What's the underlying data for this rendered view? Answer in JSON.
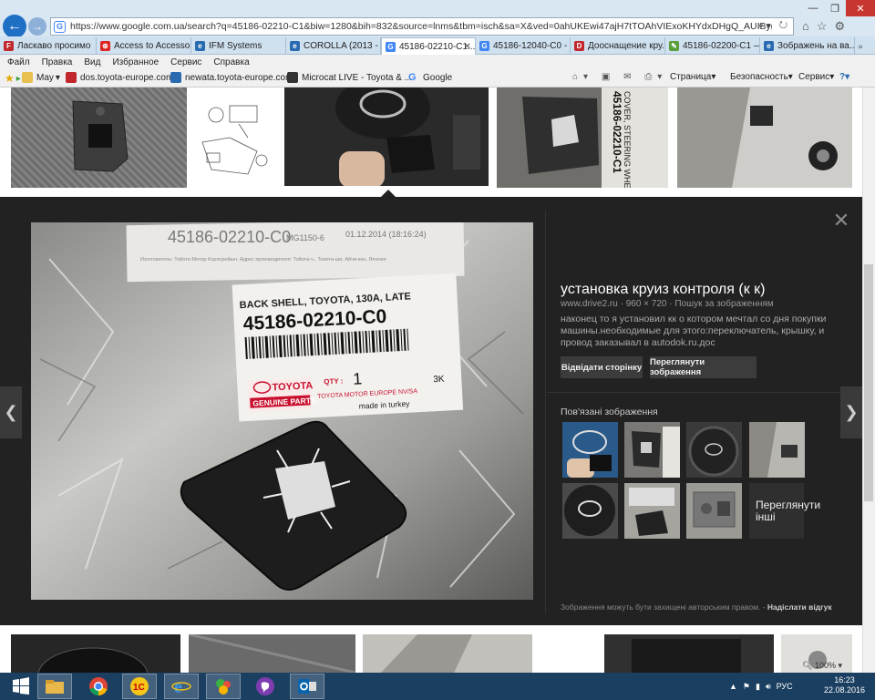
{
  "browser": {
    "url": "https://www.google.com.ua/search?q=45186-02210-C1&biw=1280&bih=832&source=lnms&tbm=isch&sa=X&ved=0ahUKEwi47ajH7tTOAhVIExoKHYdxDHgQ_AUIBygC&dpr=1#imgdii=2TJgQxLiM...",
    "tabs": [
      {
        "label": "Ласкаво просимо",
        "icon_color": "#c1272d"
      },
      {
        "label": "Access to Accessor...",
        "icon_color": "#d22"
      },
      {
        "label": "IFM Systems",
        "icon_color": "#2a6ab0"
      },
      {
        "label": "COROLLA (2013 - )...",
        "icon_color": "#2a6ab0"
      },
      {
        "label": "45186-02210-C1...",
        "icon_color": "#4285f4"
      },
      {
        "label": "45186-12040-C0 - ...",
        "icon_color": "#4285f4"
      },
      {
        "label": "Дооснащение кру...",
        "icon_color": "#c1272d"
      },
      {
        "label": "45186-02200-C1 — ...",
        "icon_color": "#5a9e3a"
      },
      {
        "label": "Зображень на ва...",
        "icon_color": "#2a6ab0"
      }
    ],
    "menu": [
      "Файл",
      "Правка",
      "Вид",
      "Избранное",
      "Сервис",
      "Справка"
    ],
    "favorites": [
      "May",
      "dos.toyota-europe.com",
      "newata.toyota-europe.com",
      "Microcat LIVE - Toyota & ...",
      "Google"
    ],
    "commands": [
      "Страница",
      "Безопасность",
      "Сервис"
    ],
    "zoom": "100%"
  },
  "viewer": {
    "title": "установка круиз контроля (к к)",
    "source": "www.drive2.ru",
    "size": "960 × 720",
    "search_link": "Пошук за зображенням",
    "description": "наконец то я установил кк о котором мечтал со дня покупки машины.необходимые для этого:переключатель, крышку, и провод заказывал в autodok.ru.дос",
    "visit_button": "Відвідати сторінку",
    "view_button": "Переглянути зображення",
    "related_label": "Пов'язані зображення",
    "more_label": "Переглянути інші",
    "copyright_note": "Зображення можуть бути захищені авторським правом.",
    "feedback_link": "Надіслати відгук",
    "label": {
      "part_top": "45186-02210-C0",
      "mg": "MG1150-6",
      "date": "01.12.2014 (18:16:24)",
      "importer_line": "Изготовитель: Тойота Мотор Корпорейшн. Адрес производителя: Тойота-ч., Тоиота-ши, Айчи-кен, Япония",
      "desc": "BACK SHELL, TOYOTA, 130A, LATE",
      "part_no": "45186-02210-C0",
      "brand": "TOYOTA",
      "genuine": "GENUINE PARTS",
      "qty_label": "QTY :",
      "qty": "1",
      "supplier": "TOYOTA MOTOR EUROPE NV/SA",
      "code": "3K",
      "origin": "made in turkey"
    },
    "thumb_label": {
      "line1": "COVER, STEERING WHEE",
      "line2": "45186-02210-C1"
    }
  },
  "taskbar": {
    "lang": "РУС",
    "time": "16:23",
    "date": "22.08.2016",
    "ie_logo": "e",
    "onec_logo": "1С"
  }
}
